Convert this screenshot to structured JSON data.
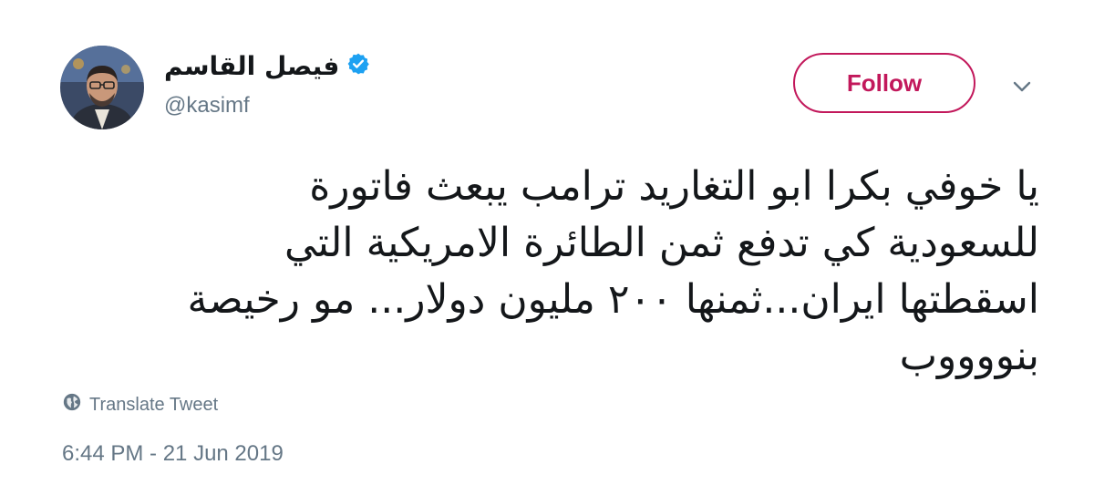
{
  "user": {
    "display_name": "فيصل القاسم",
    "handle": "@kasimf",
    "verified": true
  },
  "actions": {
    "follow_label": "Follow",
    "accent_color": "#c2185b"
  },
  "tweet": {
    "lines": [
      "يا خوفي بكرا ابو التغاريد ترامب يبعث فاتورة",
      "للسعودية كي تدفع ثمن الطائرة الامريكية التي",
      "اسقطتها ايران...ثمنها ٢٠٠ مليون دولار... مو رخيصة",
      "بنووووب"
    ],
    "translate_label": "Translate Tweet",
    "timestamp": "6:44 PM - 21 Jun 2019"
  },
  "icons": {
    "verified": "verified-badge-icon",
    "caret": "chevron-down-icon",
    "translate": "globe-icon"
  }
}
